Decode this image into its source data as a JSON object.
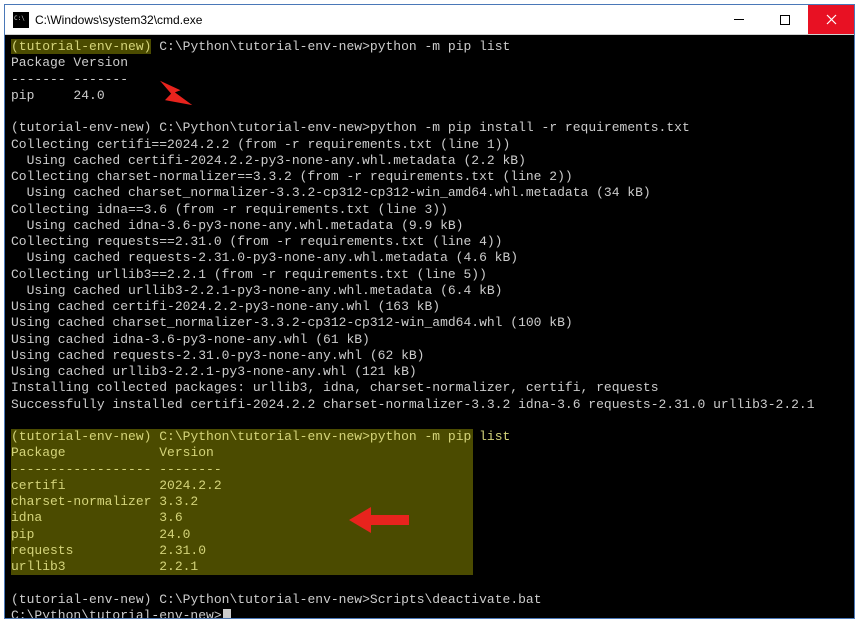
{
  "titlebar": {
    "title": "C:\\Windows\\system32\\cmd.exe"
  },
  "venv_name": "(tutorial-env-new)",
  "prompt_path": "C:\\Python\\tutorial-env-new>",
  "commands": {
    "pip_list": "python -m pip list",
    "pip_install": "python -m pip install -r requirements.txt",
    "deactivate": "Scripts\\deactivate.bat"
  },
  "pip_list_before": {
    "header1": "Package",
    "header2": "Version",
    "sep1": "-------",
    "sep2": "-------",
    "rows": [
      {
        "pkg": "pip    ",
        "ver": "24.0"
      }
    ]
  },
  "install_output": [
    "Collecting certifi==2024.2.2 (from -r requirements.txt (line 1))",
    "  Using cached certifi-2024.2.2-py3-none-any.whl.metadata (2.2 kB)",
    "Collecting charset-normalizer==3.3.2 (from -r requirements.txt (line 2))",
    "  Using cached charset_normalizer-3.3.2-cp312-cp312-win_amd64.whl.metadata (34 kB)",
    "Collecting idna==3.6 (from -r requirements.txt (line 3))",
    "  Using cached idna-3.6-py3-none-any.whl.metadata (9.9 kB)",
    "Collecting requests==2.31.0 (from -r requirements.txt (line 4))",
    "  Using cached requests-2.31.0-py3-none-any.whl.metadata (4.6 kB)",
    "Collecting urllib3==2.2.1 (from -r requirements.txt (line 5))",
    "  Using cached urllib3-2.2.1-py3-none-any.whl.metadata (6.4 kB)",
    "Using cached certifi-2024.2.2-py3-none-any.whl (163 kB)",
    "Using cached charset_normalizer-3.3.2-cp312-cp312-win_amd64.whl (100 kB)",
    "Using cached idna-3.6-py3-none-any.whl (61 kB)",
    "Using cached requests-2.31.0-py3-none-any.whl (62 kB)",
    "Using cached urllib3-2.2.1-py3-none-any.whl (121 kB)",
    "Installing collected packages: urllib3, idna, charset-normalizer, certifi, requests",
    "Successfully installed certifi-2024.2.2 charset-normalizer-3.3.2 idna-3.6 requests-2.31.0 urllib3-2.2.1"
  ],
  "pip_list_after": {
    "header1": "Package           ",
    "header2": "Version",
    "sep1": "------------------",
    "sep2": "--------",
    "rows": [
      {
        "pkg": "certifi           ",
        "ver": "2024.2.2"
      },
      {
        "pkg": "charset-normalizer",
        "ver": "3.3.2"
      },
      {
        "pkg": "idna              ",
        "ver": "3.6"
      },
      {
        "pkg": "pip               ",
        "ver": "24.0"
      },
      {
        "pkg": "requests          ",
        "ver": "2.31.0"
      },
      {
        "pkg": "urllib3           ",
        "ver": "2.2.1"
      }
    ]
  },
  "final_prompt": "C:\\Python\\tutorial-env-new>",
  "annotation_color": "#e8231d"
}
